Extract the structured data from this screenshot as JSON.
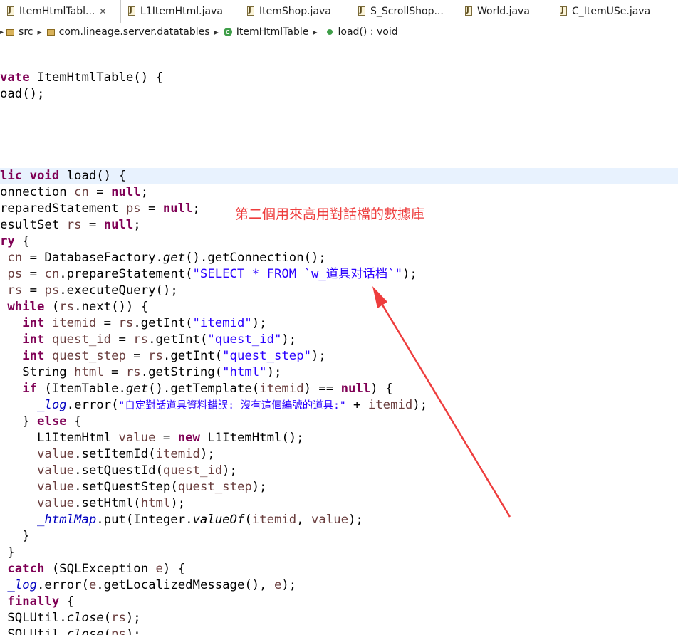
{
  "tabs": [
    {
      "label": "ItemHtmlTabl...",
      "close": "✕",
      "active": true
    },
    {
      "label": "L1ItemHtml.java"
    },
    {
      "label": "ItemShop.java"
    },
    {
      "label": "S_ScrollShop..."
    },
    {
      "label": "World.java"
    },
    {
      "label": "C_ItemUSe.java"
    }
  ],
  "breadcrumb": {
    "src": "src",
    "package": "com.lineage.server.datatables",
    "class": "ItemHtmlTable",
    "method": "load() : void"
  },
  "code": {
    "l1": {
      "a": "vate",
      "b": " ItemHtmlTable() {"
    },
    "l2": {
      "a": "oad();"
    },
    "l3": {
      "a": "lic",
      "b": " ",
      "c": "void",
      "d": " load() {"
    },
    "l4": {
      "a": "onnection ",
      "b": "cn",
      "c": " = ",
      "d": "null",
      "e": ";"
    },
    "l5": {
      "a": "reparedStatement ",
      "b": "ps",
      "c": " = ",
      "d": "null",
      "e": ";"
    },
    "l6": {
      "a": "esultSet ",
      "b": "rs",
      "c": " = ",
      "d": "null",
      "e": ";"
    },
    "l7": {
      "a": "ry",
      "b": " {"
    },
    "l8": {
      "a": " ",
      "b": "cn",
      "c": " = DatabaseFactory.",
      "d": "get",
      "e": "().getConnection();"
    },
    "l9": {
      "a": " ",
      "b": "ps",
      "c": " = ",
      "d": "cn",
      "e": ".prepareStatement(",
      "f": "\"SELECT * FROM `w_道具对话档`\"",
      "g": ");"
    },
    "l10": {
      "a": " ",
      "b": "rs",
      "c": " = ",
      "d": "ps",
      "e": ".executeQuery();"
    },
    "l11": {
      "a": " ",
      "b": "while",
      "c": " (",
      "d": "rs",
      "e": ".next()) {"
    },
    "l12": {
      "a": "   ",
      "b": "int",
      "c": " ",
      "d": "itemid",
      "e": " = ",
      "f": "rs",
      "g": ".getInt(",
      "h": "\"itemid\"",
      "i": ");"
    },
    "l13": {
      "a": "   ",
      "b": "int",
      "c": " ",
      "d": "quest_id",
      "e": " = ",
      "f": "rs",
      "g": ".getInt(",
      "h": "\"quest_id\"",
      "i": ");"
    },
    "l14": {
      "a": "   ",
      "b": "int",
      "c": " ",
      "d": "quest_step",
      "e": " = ",
      "f": "rs",
      "g": ".getInt(",
      "h": "\"quest_step\"",
      "i": ");"
    },
    "l15": {
      "a": "   String ",
      "b": "html",
      "c": " = ",
      "d": "rs",
      "e": ".getString(",
      "f": "\"html\"",
      "g": ");"
    },
    "l16": {
      "a": "   ",
      "b": "if",
      "c": " (ItemTable.",
      "d": "get",
      "e": "().getTemplate(",
      "f": "itemid",
      "g": ") == ",
      "h": "null",
      "i": ") {"
    },
    "l17": {
      "a": "     ",
      "b": "_log",
      "c": ".error(",
      "d": "\"自定對話道具資料錯誤: 沒有這個編號的道具:\"",
      "e": " + ",
      "f": "itemid",
      "g": ");"
    },
    "l18": {
      "a": "   } ",
      "b": "else",
      "c": " {"
    },
    "l19": {
      "a": "     L1ItemHtml ",
      "b": "value",
      "c": " = ",
      "d": "new",
      "e": " L1ItemHtml();"
    },
    "l20": {
      "a": "     ",
      "b": "value",
      "c": ".setItemId(",
      "d": "itemid",
      "e": ");"
    },
    "l21": {
      "a": "     ",
      "b": "value",
      "c": ".setQuestId(",
      "d": "quest_id",
      "e": ");"
    },
    "l22": {
      "a": "     ",
      "b": "value",
      "c": ".setQuestStep(",
      "d": "quest_step",
      "e": ");"
    },
    "l23": {
      "a": "     ",
      "b": "value",
      "c": ".setHtml(",
      "d": "html",
      "e": ");"
    },
    "l24": {
      "a": "     ",
      "b": "_htmlMap",
      "c": ".put(Integer.",
      "d": "valueOf",
      "e": "(",
      "f": "itemid",
      "g": ", ",
      "h": "value",
      "i": ");"
    },
    "l25": {
      "a": "   }"
    },
    "l26": {
      "a": " }"
    },
    "l27": {
      "a": " ",
      "b": "catch",
      "c": " (SQLException ",
      "d": "e",
      "e": ") {"
    },
    "l28": {
      "a": " ",
      "b": "_log",
      "c": ".error(",
      "d": "e",
      "e": ".getLocalizedMessage(), ",
      "f": "e",
      "g": ");"
    },
    "l29": {
      "a": " ",
      "b": "finally",
      "c": " {"
    },
    "l30": {
      "a": " SQLUtil.",
      "b": "close",
      "c": "(",
      "d": "rs",
      "e": ");"
    },
    "l31": {
      "a": " SQLUtil.",
      "b": "close",
      "c": "(",
      "d": "ps",
      "e": ");"
    }
  },
  "annotation": "第二個用來高用對話檔的數據庫",
  "colors": {
    "keyword": "#7f0055",
    "string": "#2a00ff",
    "field": "#0000c0",
    "local_var": "#6a3e3e",
    "annotation": "#ee3d3d",
    "current_line": "#e8f2fe"
  },
  "icons": {
    "tab_file": "java-file-icon",
    "src": "source-folder-icon",
    "package": "package-icon",
    "class": "class-icon",
    "method": "public-method-icon"
  }
}
